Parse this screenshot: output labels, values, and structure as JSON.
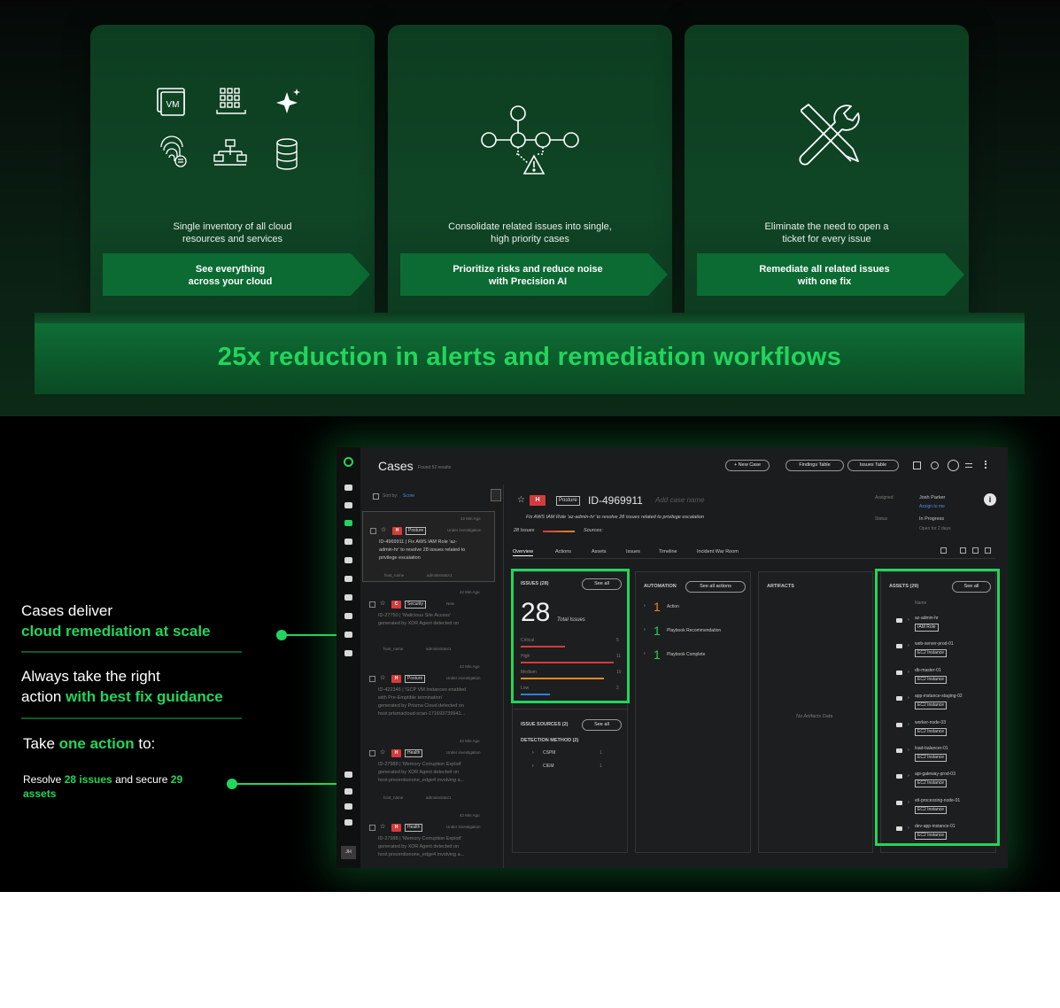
{
  "colors": {
    "accent": "#22d55c",
    "card": "#0f4525",
    "critical": "#d43b3b",
    "high": "#d43b3b",
    "medium": "#e08a2a",
    "low": "#2f7de1"
  },
  "cards": [
    {
      "description": "Single inventory of all cloud resources and services",
      "desc_line1": "Single inventory of all cloud",
      "desc_line2": "resources and services",
      "banner_line1": "See everything",
      "banner_line2": "across your cloud",
      "icons": [
        "vm-icon",
        "grid-icon",
        "sparkle-icon",
        "fingerprint-icon",
        "network-icon",
        "database-icon"
      ],
      "vm_label": "VM"
    },
    {
      "description": "Consolidate related issues into single, high priority cases",
      "desc_line1": "Consolidate related issues into single,",
      "desc_line2": "high priority cases",
      "banner_line1": "Prioritize risks and reduce noise",
      "banner_line2": "with Precision AI",
      "icons": [
        "issue-graph-icon"
      ]
    },
    {
      "description": "Eliminate the need to open a ticket for every issue",
      "desc_line1": "Eliminate the need to open a",
      "desc_line2": "ticket for every issue",
      "banner_line1": "Remediate all related issues",
      "banner_line2": "with one fix",
      "icons": [
        "tools-icon"
      ]
    }
  ],
  "headline": "25x reduction in alerts and remediation workflows",
  "callouts": {
    "c1_line1": "Cases deliver",
    "c1_line2": "cloud remediation at scale",
    "c2_line1": "Always take the right",
    "c2_line2a": "action ",
    "c2_line2b": "with best fix guidance",
    "c3_a": "Take ",
    "c3_b": "one action",
    "c3_c": " to:",
    "c4_a": "Resolve ",
    "c4_b": "28 issues",
    "c4_c": " and secure ",
    "c4_d": "29",
    "c4_e": "assets"
  },
  "app": {
    "title": "Cases",
    "found": "Found 52 results",
    "buttons": {
      "new_case": "+ New Case",
      "findings_table": "Findings Table",
      "issues_table": "Issues Table"
    },
    "sort_label": "Sort by:",
    "sort_value": "Score",
    "case_list": [
      {
        "sev": "H",
        "tag": "Posture",
        "time": "42 Min Ago",
        "status": "Under investigation",
        "line1": "ID-4969911 | Fix AWS IAM Role 'az-",
        "line2": "admin-hr' to resolve 28 issues related to",
        "line3": "privilege escalation",
        "line4": "",
        "owner": "host_name",
        "user": "administrator1"
      },
      {
        "sev": "C",
        "tag": "Security",
        "time": "42 Min Ago",
        "status": "New",
        "line1": "ID-27750 | 'Malicious Site Access'",
        "line2": "generated by XDR Agent detected on",
        "line3": "",
        "line4": "",
        "owner": "host_name",
        "user": "administrator1"
      },
      {
        "sev": "H",
        "tag": "Posture",
        "time": "42 Min Ago",
        "status": "Under investigation",
        "line1": "ID-422346 | 'GCP VM Instances enabled",
        "line2": "with Pre-Emptible termination'",
        "line3": "generated by Prisma Cloud detected on",
        "line4": "host prismacloud-scan-171693739941...",
        "owner": "",
        "user": ""
      },
      {
        "sev": "H",
        "tag": "Health",
        "time": "42 Min Ago",
        "status": "Under investigation",
        "line1": "ID-27988 | 'Memory Corruption Exploit'",
        "line2": "generated by XDR Agent detected on",
        "line3": "host preventionone_edge4 involving a...",
        "line4": "",
        "owner": "host_name",
        "user": "administrator1"
      },
      {
        "sev": "H",
        "tag": "Health",
        "time": "42 Min Ago",
        "status": "Under investigation",
        "line1": "ID-27988 | 'Memory Corruption Exploit'",
        "line2": "generated by XDR Agent detected on",
        "line3": "host preventionone_edge4 involving a...",
        "line4": "",
        "owner": "",
        "user": ""
      }
    ],
    "detail": {
      "sev": "H",
      "tag": "Posture",
      "id": "ID-4969911",
      "name_placeholder": "Add case name",
      "subtitle": "Fix AWS IAM Role 'az-admin-hr' to resolve 28 issues related to privilege escalation",
      "issues_count": "28 Issues",
      "sources_label": "Sources:",
      "assigned_label": "Assigned",
      "assigned_value": "Josh Parker",
      "assign_me": "Assign to me",
      "status_label": "Status",
      "status_value": "In Progress",
      "open_for": "Open for 2 days",
      "tabs": [
        "Overview",
        "Actions",
        "Assets",
        "Issues",
        "Timeline",
        "Incident War Room"
      ],
      "issues_panel": {
        "title": "ISSUES (28)",
        "see_all": "See all",
        "big": "28",
        "total_label": "Total Issues",
        "rows": [
          {
            "label": "Critical",
            "count": "5",
            "fill": 0.45
          },
          {
            "label": "High",
            "count": "11",
            "fill": 0.95
          },
          {
            "label": "Medium",
            "count": "10",
            "fill": 0.85
          },
          {
            "label": "Low",
            "count": "2",
            "fill": 0.3
          }
        ]
      },
      "sources_panel": {
        "title": "ISSUE SOURCES (2)",
        "see_all": "See all",
        "method": "DETECTION METHOD (2)",
        "rows": [
          {
            "label": "CSPM",
            "count": "1"
          },
          {
            "label": "CIEM",
            "count": "1"
          }
        ]
      },
      "automation_panel": {
        "title": "AUTOMATION",
        "see_all": "See all actions",
        "rows": [
          {
            "n": "1",
            "label": "Action"
          },
          {
            "n": "1",
            "label": "Playbook Recommendation"
          },
          {
            "n": "1",
            "label": "Playbook Complete"
          }
        ]
      },
      "artifacts_panel": {
        "title": "ARTIFACTS",
        "empty": "No Artifacts Data"
      },
      "assets_panel": {
        "title": "ASSETS (29)",
        "see_all": "See all",
        "col": "Name",
        "rows": [
          {
            "name": "az-admin-hr",
            "type": "IAM Role"
          },
          {
            "name": "web-server-prod-01",
            "type": "EC2 Instance"
          },
          {
            "name": "db-master-01",
            "type": "EC2 Instance"
          },
          {
            "name": "app-instance-staging-02",
            "type": "EC2 Instance"
          },
          {
            "name": "worker-node-03",
            "type": "EC2 Instance"
          },
          {
            "name": "load-balancer-01",
            "type": "EC2 Instance"
          },
          {
            "name": "api-gateway-prod-03",
            "type": "EC2 Instance"
          },
          {
            "name": "etl-processing-node-01",
            "type": "EC2 Instance"
          },
          {
            "name": "dev-app-instance-01",
            "type": "EC2 Instance"
          }
        ]
      }
    },
    "avatar": "JH"
  }
}
